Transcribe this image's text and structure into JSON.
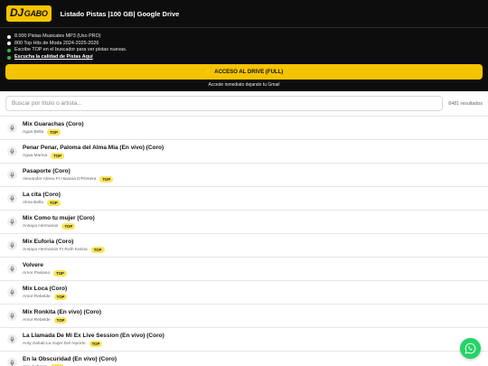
{
  "header": {
    "logo_a": "DJ",
    "logo_b": "GABO",
    "title": "Listado Pistas |100 GB| Google Drive"
  },
  "info": [
    {
      "text": "8.000 Pistas Musicales MP3 (Uso PRO)",
      "dot_color": "#ffffff"
    },
    {
      "text": "800 Top Hits de Moda 2024-2025-2026",
      "dot_color": "#ffffff"
    },
    {
      "text": "Escribe TOP en el buscador para ver pistas nuevas.",
      "dot_color": "#2fbf4a"
    },
    {
      "text": "Escucha la calidad de Pistas Aquí",
      "dot_color": "#2fbf4a"
    }
  ],
  "cta": {
    "label": "ACCESO AL DRIVE (FULL)",
    "sub": "Accede inmediato dejando tu Gmail"
  },
  "search": {
    "placeholder": "Buscar por título o artista...",
    "value": "",
    "count": "8481 resultados"
  },
  "badge_label": "TOP",
  "songs": [
    {
      "title": "Mix Guarachas (Coro)",
      "artist": "Agua Bella"
    },
    {
      "title": "Penar Penar, Paloma del Alma Mia (En vivo) (Coro)",
      "artist": "Agua Marina"
    },
    {
      "title": "Pasaporte (Coro)",
      "artist": "Alexander Abreu Ft Havana D'Primera"
    },
    {
      "title": "La cita (Coro)",
      "artist": "Alma Bella"
    },
    {
      "title": "Mix Como tu mujer (Coro)",
      "artist": "Ansaya Hermanos"
    },
    {
      "title": "Mix Euforia (Coro)",
      "artist": "Ansaya Hermanos Ft Ruth Karina"
    },
    {
      "title": "Volvere",
      "artist": "Amor Pasiano"
    },
    {
      "title": "Mix Loca (Coro)",
      "artist": "Amor Rebelde"
    },
    {
      "title": "Mix Ronkita (En vivo) (Coro)",
      "artist": "Amor Rebelde"
    },
    {
      "title": "La Llamada De Mi Ex Live Session (En vivo) (Coro)",
      "artist": "Anty Sahati La mujer Del reporto"
    },
    {
      "title": "En la Obscuridad (En vivo) (Coro)",
      "artist": "Ana Cabrera"
    }
  ],
  "colors": {
    "accent": "#f5c400",
    "badge": "#fbe55a",
    "whatsapp": "#25d366",
    "header_bg": "#0d0d0d"
  },
  "icons": {
    "row": "microphone-icon",
    "cta": "lightning-icon",
    "floating": "whatsapp-icon"
  }
}
